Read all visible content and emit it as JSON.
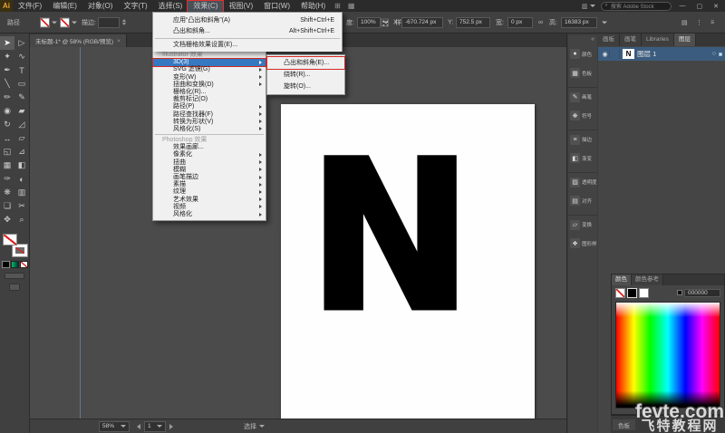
{
  "colors": {
    "accent_blue": "#3679c0",
    "layer_selection_blue": "#3b5c7e",
    "annotation_red": "#d42a22",
    "menu_bg": "#f0f0f0",
    "panel_bg": "#454545",
    "canvas_bg": "#4b4b4b",
    "hex_value_color": "#000000"
  },
  "icons": {
    "eye": "◉",
    "target": "○",
    "panel_menu": "≡",
    "search": "⌕",
    "collapse": "«",
    "link": "∞",
    "refgrid": "▦",
    "bridge": "⊞",
    "arrange": "▦",
    "workspace": "▥",
    "cb_icon1": "▤",
    "cb_icon2": "⋮",
    "cb_icon3": "≡"
  },
  "title_bar": {
    "logo": "Ai",
    "menus": [
      {
        "label": "文件(F)",
        "name": "file-menu"
      },
      {
        "label": "编辑(E)",
        "name": "edit-menu"
      },
      {
        "label": "对象(O)",
        "name": "object-menu"
      },
      {
        "label": "文字(T)",
        "name": "type-menu"
      },
      {
        "label": "选择(S)",
        "name": "select-menu"
      },
      {
        "label": "效果(C)",
        "name": "effect-menu",
        "highlighted": true
      },
      {
        "label": "视图(V)",
        "name": "view-menu"
      },
      {
        "label": "窗口(W)",
        "name": "window-menu"
      },
      {
        "label": "帮助(H)",
        "name": "help-menu"
      }
    ],
    "search_text": "搜索 Adobe Stock",
    "window_buttons": {
      "minimize": "—",
      "maximize": "▢",
      "close": "✕"
    }
  },
  "control_bar": {
    "selection_label": "路径",
    "stroke_label": "描边:",
    "opacity_label": "度:",
    "opacity_value": "100%",
    "style_label": "样式:",
    "x_label": "X:",
    "x_value": "-670.724 px",
    "y_label": "Y:",
    "y_value": "752.5 px",
    "w_label": "宽:",
    "w_value": "0 px",
    "h_label": "高:",
    "h_value": "16383 px"
  },
  "toolbar": {
    "tools": [
      {
        "glyph": "➤",
        "name": "selection-tool",
        "selected": true
      },
      {
        "glyph": "▷",
        "name": "direct-selection-tool"
      },
      {
        "glyph": "✦",
        "name": "magic-wand-tool"
      },
      {
        "glyph": "∿",
        "name": "lasso-tool"
      },
      {
        "glyph": "✒",
        "name": "pen-tool"
      },
      {
        "glyph": "T",
        "name": "type-tool"
      },
      {
        "glyph": "╲",
        "name": "line-segment-tool"
      },
      {
        "glyph": "▭",
        "name": "rectangle-tool"
      },
      {
        "glyph": "✏",
        "name": "paintbrush-tool"
      },
      {
        "glyph": "✎",
        "name": "pencil-tool"
      },
      {
        "glyph": "◉",
        "name": "blob-brush-tool"
      },
      {
        "glyph": "▰",
        "name": "eraser-tool"
      },
      {
        "glyph": "↻",
        "name": "rotate-tool"
      },
      {
        "glyph": "◿",
        "name": "scale-tool"
      },
      {
        "glyph": "↔",
        "name": "width-tool"
      },
      {
        "glyph": "▱",
        "name": "free-transform-tool"
      },
      {
        "glyph": "◱",
        "name": "shape-builder-tool"
      },
      {
        "glyph": "⊿",
        "name": "perspective-grid-tool"
      },
      {
        "glyph": "▦",
        "name": "mesh-tool"
      },
      {
        "glyph": "◧",
        "name": "gradient-tool"
      },
      {
        "glyph": "✑",
        "name": "eyedropper-tool"
      },
      {
        "glyph": "◐",
        "name": "blend-tool"
      },
      {
        "glyph": "❋",
        "name": "symbol-sprayer-tool"
      },
      {
        "glyph": "▥",
        "name": "column-graph-tool"
      },
      {
        "glyph": "❏",
        "name": "artboard-tool"
      },
      {
        "glyph": "✂",
        "name": "slice-tool"
      },
      {
        "glyph": "✥",
        "name": "hand-tool"
      },
      {
        "glyph": "⌕",
        "name": "zoom-tool"
      }
    ]
  },
  "document_tab": {
    "title": "未标题-1* @ 58% (RGB/预览)",
    "close": "×"
  },
  "effect_menu": {
    "top_items": [
      {
        "label": "应用“凸出和斜角”(A)",
        "shortcut": "Shift+Ctrl+E",
        "name": "apply-extrude-bevel"
      },
      {
        "label": "凸出和斜角...",
        "shortcut": "Alt+Shift+Ctrl+E",
        "name": "extrude-bevel"
      },
      {
        "type": "separator"
      },
      {
        "label": "文档栅格效果设置(E)...",
        "name": "document-raster-effects-settings"
      }
    ],
    "items": [
      {
        "type": "header",
        "label": "Illustrator 效果",
        "name": "illustrator-effects-header"
      },
      {
        "label": "3D(3)",
        "arrow": true,
        "highlighted": true,
        "redbox": true,
        "name": "3d-item"
      },
      {
        "label": "SVG 滤镜(G)",
        "arrow": true,
        "name": "svg-filters-item"
      },
      {
        "label": "变形(W)",
        "arrow": true,
        "name": "warp-item"
      },
      {
        "label": "扭曲和变换(D)",
        "arrow": true,
        "name": "distort-transform-item"
      },
      {
        "label": "栅格化(R)...",
        "name": "rasterize-item"
      },
      {
        "label": "裁剪标记(O)",
        "name": "crop-marks-item"
      },
      {
        "label": "路径(P)",
        "arrow": true,
        "name": "path-item"
      },
      {
        "label": "路径查找器(F)",
        "arrow": true,
        "name": "pathfinder-item"
      },
      {
        "label": "转换为形状(V)",
        "arrow": true,
        "name": "convert-to-shape-item"
      },
      {
        "label": "风格化(S)",
        "arrow": true,
        "name": "stylize-item"
      },
      {
        "type": "separator"
      },
      {
        "type": "header",
        "label": "Photoshop 效果",
        "name": "photoshop-effects-header"
      },
      {
        "label": "效果画廊...",
        "name": "effect-gallery-item"
      },
      {
        "label": "像素化",
        "arrow": true,
        "name": "pixelate-item"
      },
      {
        "label": "扭曲",
        "arrow": true,
        "name": "distort-item"
      },
      {
        "label": "模糊",
        "arrow": true,
        "name": "blur-item"
      },
      {
        "label": "画笔描边",
        "arrow": true,
        "name": "brush-strokes-item"
      },
      {
        "label": "素描",
        "arrow": true,
        "name": "sketch-item"
      },
      {
        "label": "纹理",
        "arrow": true,
        "name": "texture-item"
      },
      {
        "label": "艺术效果",
        "arrow": true,
        "name": "artistic-item"
      },
      {
        "label": "视频",
        "arrow": true,
        "name": "video-item"
      },
      {
        "label": "风格化",
        "arrow": true,
        "name": "stylize-ps-item"
      }
    ]
  },
  "submenu": {
    "items": [
      {
        "label": "凸出和斜角(E)...",
        "redbox": true,
        "name": "extrude-bevel-subitem"
      },
      {
        "label": "绕转(R)...",
        "name": "revolve-subitem"
      },
      {
        "label": "旋转(O)...",
        "name": "rotate-subitem"
      }
    ]
  },
  "canvas": {
    "letter": "N"
  },
  "dock": {
    "panels": [
      {
        "glyph": "●",
        "label": "颜色",
        "name": "dock-color"
      },
      {
        "glyph": "▦",
        "label": "色板",
        "name": "dock-swatches"
      },
      {
        "glyph": "✎",
        "label": "画笔",
        "name": "dock-brushes",
        "gap": true
      },
      {
        "glyph": "❋",
        "label": "符号",
        "name": "dock-symbols"
      },
      {
        "glyph": "≡",
        "label": "描边",
        "name": "dock-stroke",
        "gap": true
      },
      {
        "glyph": "◧",
        "label": "渐变",
        "name": "dock-gradient"
      },
      {
        "glyph": "▨",
        "label": "透明度",
        "name": "dock-transparency",
        "gap": true
      },
      {
        "glyph": "▤",
        "label": "对齐",
        "name": "dock-align"
      },
      {
        "glyph": "▱",
        "label": "变换",
        "name": "dock-transform",
        "gap": true
      },
      {
        "glyph": "❖",
        "label": "图形样式",
        "name": "dock-graphic-styles"
      }
    ]
  },
  "layers_panel": {
    "tabs": [
      {
        "label": "画板",
        "name": "tab-artboards"
      },
      {
        "label": "画笔",
        "name": "tab-brushes"
      },
      {
        "label": "Libraries",
        "name": "tab-libraries"
      },
      {
        "label": "图层",
        "name": "tab-layers",
        "selected": true
      }
    ],
    "row": {
      "name": "图层 1",
      "thumb": "N"
    }
  },
  "color_panel": {
    "tabs": [
      {
        "label": "颜色",
        "name": "tab-color",
        "selected": true
      },
      {
        "label": "颜色参考",
        "name": "tab-color-guide"
      }
    ],
    "hex": "000000",
    "bottom_tab": "色板"
  },
  "status_bar": {
    "zoom": "58%",
    "artboard": "1",
    "status": "选择"
  },
  "watermark": {
    "line1": "fevte.com",
    "line2": "飞特教程网"
  }
}
